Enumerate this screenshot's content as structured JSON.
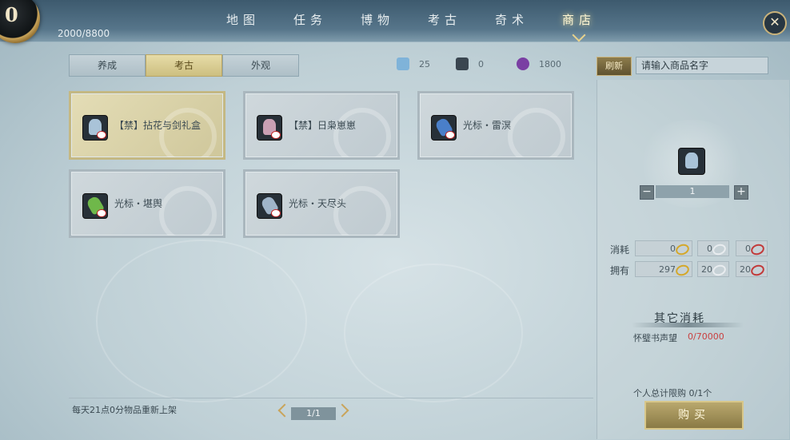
{
  "header": {
    "emblem_value": "0",
    "progress_text": "2000/8800",
    "nav": [
      {
        "label": "地图",
        "name": "nav-map"
      },
      {
        "label": "任务",
        "name": "nav-tasks"
      },
      {
        "label": "博物",
        "name": "nav-museum"
      },
      {
        "label": "考古",
        "name": "nav-archaeology"
      },
      {
        "label": "奇术",
        "name": "nav-arts"
      },
      {
        "label": "商店",
        "name": "nav-shop",
        "active": true
      }
    ],
    "close_label": "✕"
  },
  "tabs": [
    {
      "label": "养成"
    },
    {
      "label": "考古",
      "active": true
    },
    {
      "label": "外观"
    }
  ],
  "currencies": [
    {
      "value": "25",
      "color": "#7fb3d9",
      "icon": "crystal-icon"
    },
    {
      "value": "0",
      "color": "#e0e6ea",
      "icon": "feather-icon"
    },
    {
      "value": "1800",
      "color": "#7a3fa3",
      "icon": "orb-icon"
    }
  ],
  "search": {
    "refresh_label": "刷新",
    "placeholder": "请输入商品名字"
  },
  "items": [
    {
      "name": "【禁】拈花与剑礼盒",
      "selected": true,
      "icon_color": "#a9c3d8",
      "icon": "character-icon"
    },
    {
      "name": "【禁】日枭崽崽",
      "selected": false,
      "icon_color": "#c9a0b4",
      "icon": "character-icon"
    },
    {
      "name": "光标・雷溟",
      "selected": false,
      "icon_color": "#4a7fc9",
      "icon": "cursor-icon"
    },
    {
      "name": "光标・堪舆",
      "selected": false,
      "icon_color": "#6fb84a",
      "icon": "cursor-icon"
    },
    {
      "name": "光标・天尽头",
      "selected": false,
      "icon_color": "#9fb4c9",
      "icon": "cursor-icon"
    }
  ],
  "detail": {
    "quantity": "1",
    "minus_label": "−",
    "plus_label": "+",
    "cost_label": "消耗",
    "own_label": "拥有",
    "costs": [
      {
        "value": "0",
        "color": "#d4a82a"
      },
      {
        "value": "0",
        "color": "#e8ecef"
      },
      {
        "value": "0",
        "color": "#c23a3a"
      }
    ],
    "owned": [
      {
        "value": "297",
        "color": "#d4a82a"
      },
      {
        "value": "20",
        "color": "#e8ecef"
      },
      {
        "value": "20",
        "color": "#c23a3a"
      }
    ],
    "other_title": "其它消耗",
    "reputation_label": "怀璧书声望",
    "reputation_value": "0/70000",
    "limit_text": "个人总计限购  0/1个",
    "buy_label": "购买"
  },
  "footer": {
    "restock_text": "每天21点0分物品重新上架",
    "page": "1/1"
  }
}
